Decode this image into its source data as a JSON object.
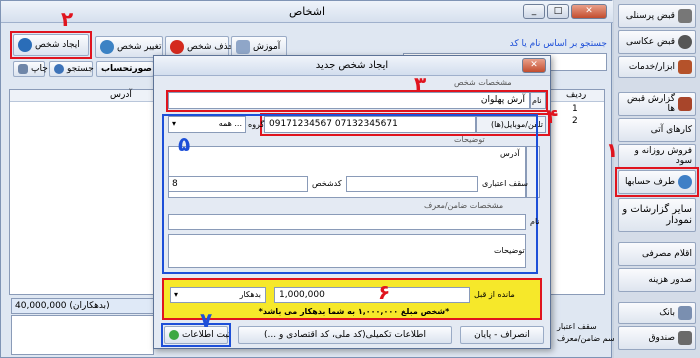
{
  "window": {
    "title": "اشخاص"
  },
  "toolbar": {
    "new_person": "ایجاد شخص",
    "change_person": "تغییر شخص",
    "delete_person": "حذف شخص",
    "training": "آموزش",
    "print": "چاپ",
    "search": "جستجو",
    "statement": "صورتحساب"
  },
  "search": {
    "label": "جستجو بر اساس نام یا کد"
  },
  "grid": {
    "headers": {
      "row": "ردیف",
      "address": "آدرس"
    },
    "rows": [
      {
        "index": "1",
        "cell": "ـ"
      },
      {
        "index": "2",
        "cell": "ـ"
      }
    ]
  },
  "footer": {
    "balance": "40,000,000 (بدهکاران)",
    "credit_limit": "سقف اعتبار",
    "guarantor_name": "اسم ضامن/معرف"
  },
  "sidebar": {
    "items": [
      "قبض پرسنلی",
      "قبض عکاسی",
      "ابزار/خدمات",
      "گزارش قبض ها",
      "کارهای آتی",
      "فروش روزانه و سود",
      "طرف حسابها",
      "سایر گزارشات و نمودار",
      "اقلام مصرفی",
      "صدور هزینه",
      "بانک",
      "صندوق"
    ]
  },
  "dialog": {
    "title": "ایجاد شخص جدید",
    "section_person": "مشخصات شخص",
    "name_label": "نام",
    "name_value": "آرش پهلوان",
    "phone_label": "تلفن/موبایل(ها)",
    "phone_value": "09171234567 07132345671",
    "group_label": "گروه",
    "group_value": "همه ...",
    "notes_label": "توضیحات",
    "address_label": "آدرس",
    "credit_label": "سقف اعتباری",
    "code_label": "کدشخص",
    "code_value": "8",
    "guarantor_section": "مشخصات ضامن/معرف",
    "guarantor_name_label": "نام",
    "guarantor_notes_label": "توضیحات",
    "previous_balance_label": "مانده از قبل",
    "previous_balance_value": "1,000,000",
    "debtor_option": "بدهکار",
    "balance_message": "*شخص مبلغ ۱,۰۰۰,۰۰۰ به شما بدهکار می باشد*",
    "cancel": "انصراف - پایان",
    "extra_info": "اطلاعات تکمیلی(کد ملی، کد اقتصادی و ...)",
    "save": "ثبت اطلاعات"
  },
  "annotations": [
    "۱",
    "۲",
    "۳",
    "۴",
    "۵",
    "۶",
    "۷"
  ],
  "colors": {
    "annotation_red": "#e0141e",
    "annotation_blue": "#1d4fd8",
    "message_bg": "#f6e82a"
  }
}
